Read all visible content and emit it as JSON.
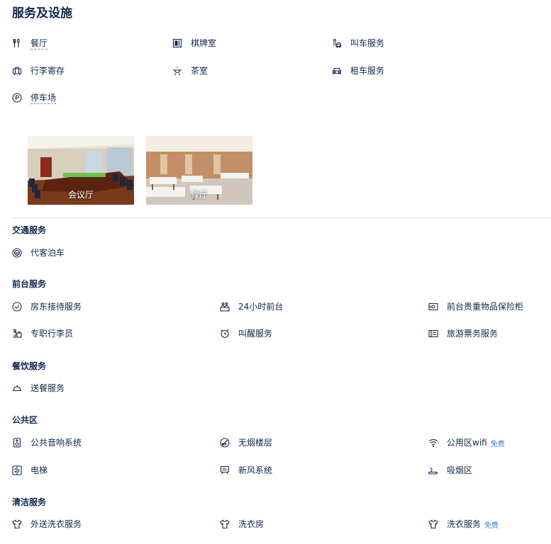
{
  "title": "服务及设施",
  "top_facilities": {
    "restaurant": "餐厅",
    "chess_room": "棋牌室",
    "taxi_service": "叫车服务",
    "luggage_storage": "行李寄存",
    "tea_room": "茶室",
    "car_rental": "租车服务",
    "parking": "停车场"
  },
  "photos": [
    {
      "caption": "会议厅"
    },
    {
      "caption": "餐厅"
    }
  ],
  "sections": {
    "transport": {
      "title": "交通服务",
      "items": [
        "代客泊车"
      ]
    },
    "front_desk": {
      "title": "前台服务",
      "items": [
        "房东接待服务",
        "24小时前台",
        "前台贵重物品保险柜",
        "专职行李员",
        "叫醒服务",
        "旅游票务服务"
      ]
    },
    "dining": {
      "title": "餐饮服务",
      "items": [
        "送餐服务"
      ]
    },
    "public": {
      "title": "公共区",
      "items": [
        "公共音响系统",
        "无烟楼层",
        "公用区wifi",
        "电梯",
        "新风系统",
        "吸烟区"
      ],
      "wifi_tag": "免费"
    },
    "cleaning": {
      "title": "清洁服务",
      "items": [
        "外送洗衣服务",
        "洗衣房",
        "洗衣服务"
      ],
      "laundry_tag": "免费"
    }
  }
}
